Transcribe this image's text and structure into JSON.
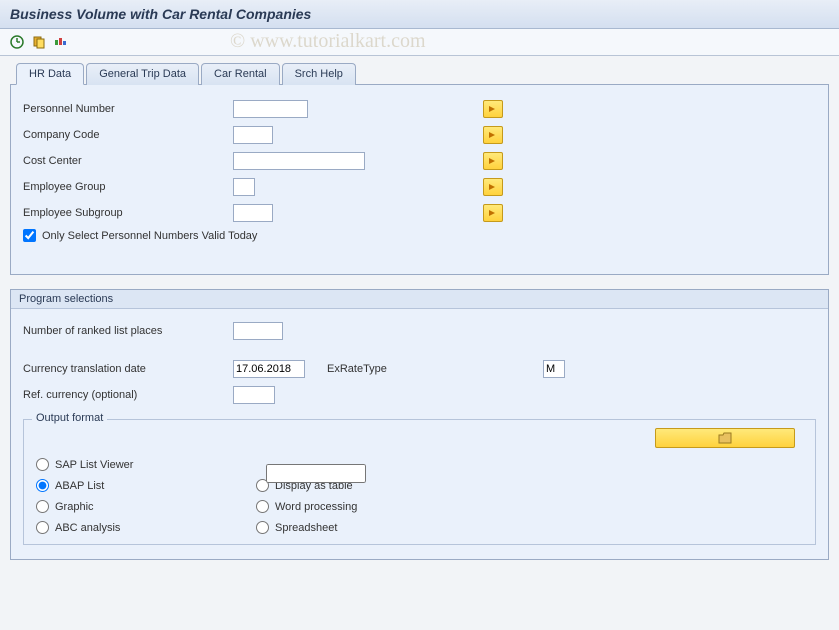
{
  "title": "Business Volume with Car Rental Companies",
  "watermark": "© www.tutorialkart.com",
  "tabs": [
    {
      "label": "HR Data"
    },
    {
      "label": "General Trip Data"
    },
    {
      "label": "Car Rental"
    },
    {
      "label": "Srch Help"
    }
  ],
  "hr_fields": {
    "personnel_number": {
      "label": "Personnel Number",
      "value": ""
    },
    "company_code": {
      "label": "Company Code",
      "value": ""
    },
    "cost_center": {
      "label": "Cost Center",
      "value": ""
    },
    "employee_group": {
      "label": "Employee Group",
      "value": ""
    },
    "employee_subgroup": {
      "label": "Employee Subgroup",
      "value": ""
    },
    "only_valid_today": {
      "label": "Only Select Personnel Numbers Valid Today",
      "checked": true
    }
  },
  "program_selections": {
    "title": "Program selections",
    "ranked_places": {
      "label": "Number of ranked list places",
      "value": ""
    },
    "currency_date": {
      "label": "Currency translation date",
      "value": "17.06.2018"
    },
    "exratetype": {
      "label": "ExRateType",
      "value": "M"
    },
    "ref_currency": {
      "label": "Ref. currency (optional)",
      "value": ""
    }
  },
  "output_format": {
    "title": "Output format",
    "layout_value": "",
    "options": {
      "sap_list_viewer": "SAP List Viewer",
      "abap_list": "ABAP List",
      "graphic": "Graphic",
      "abc_analysis": "ABC analysis",
      "display_table": "Display as table",
      "word_processing": "Word processing",
      "spreadsheet": "Spreadsheet"
    },
    "selected": "abap_list"
  }
}
